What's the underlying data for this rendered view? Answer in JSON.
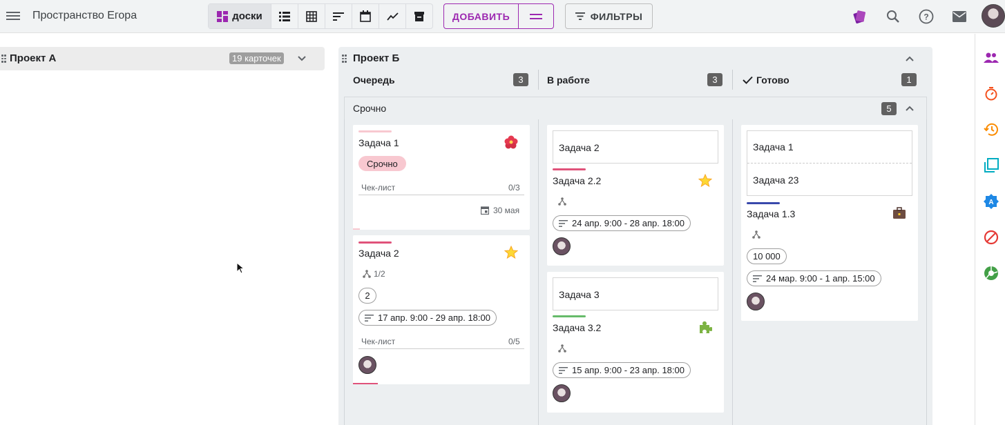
{
  "topbar": {
    "space_title": "Пространство Егора",
    "boards_label": "доски",
    "add_label": "ДОБАВИТЬ",
    "filters_label": "ФИЛЬТРЫ",
    "view_icons": [
      "list-view-icon",
      "table-view-icon",
      "gantt-view-icon",
      "calendar-view-icon",
      "chart-view-icon",
      "archive-view-icon"
    ]
  },
  "project_a": {
    "title": "Проект А",
    "count": "19 карточек"
  },
  "project_b": {
    "title": "Проект Б",
    "columns": [
      {
        "title": "Очередь",
        "count": "3"
      },
      {
        "title": "В работе",
        "count": "3"
      },
      {
        "title": "Готово",
        "count": "1"
      }
    ],
    "swimlane": {
      "title": "Срочно",
      "count": "5"
    }
  },
  "cards": {
    "c1": {
      "title": "Задача 1",
      "tag": "Срочно",
      "checklist": "Чек-лист",
      "checklist_count": "0/3",
      "due": "30 мая",
      "icon": "hibiscus"
    },
    "c2": {
      "title": "Задача 2",
      "subtasks": "1/2",
      "number": "2",
      "period": "17 апр. 9:00 - 29 апр. 18:00",
      "checklist": "Чек-лист",
      "checklist_count": "0/5",
      "icon": "star"
    },
    "c3": {
      "parent": "Задача 2",
      "title": "Задача 2.2",
      "period": "24 апр. 9:00 - 28 апр. 18:00",
      "icon": "star"
    },
    "c4": {
      "parent": "Задача 3",
      "title": "Задача 3.2",
      "period": "15 апр. 9:00 - 23 апр. 18:00",
      "icon": "puzzle"
    },
    "c5": {
      "parent1": "Задача 1",
      "parent2": "Задача 23",
      "title": "Задача 1.3",
      "number": "10 000",
      "period": "24 мар. 9:00 - 1 апр. 15:00",
      "icon": "briefcase"
    }
  },
  "colors": {
    "accent": "#9c27b0",
    "urgent_tag": "#f8c8d0",
    "stripe_pink": "#e0527a",
    "stripe_green": "#66bb6a",
    "stripe_navy": "#3949ab"
  }
}
